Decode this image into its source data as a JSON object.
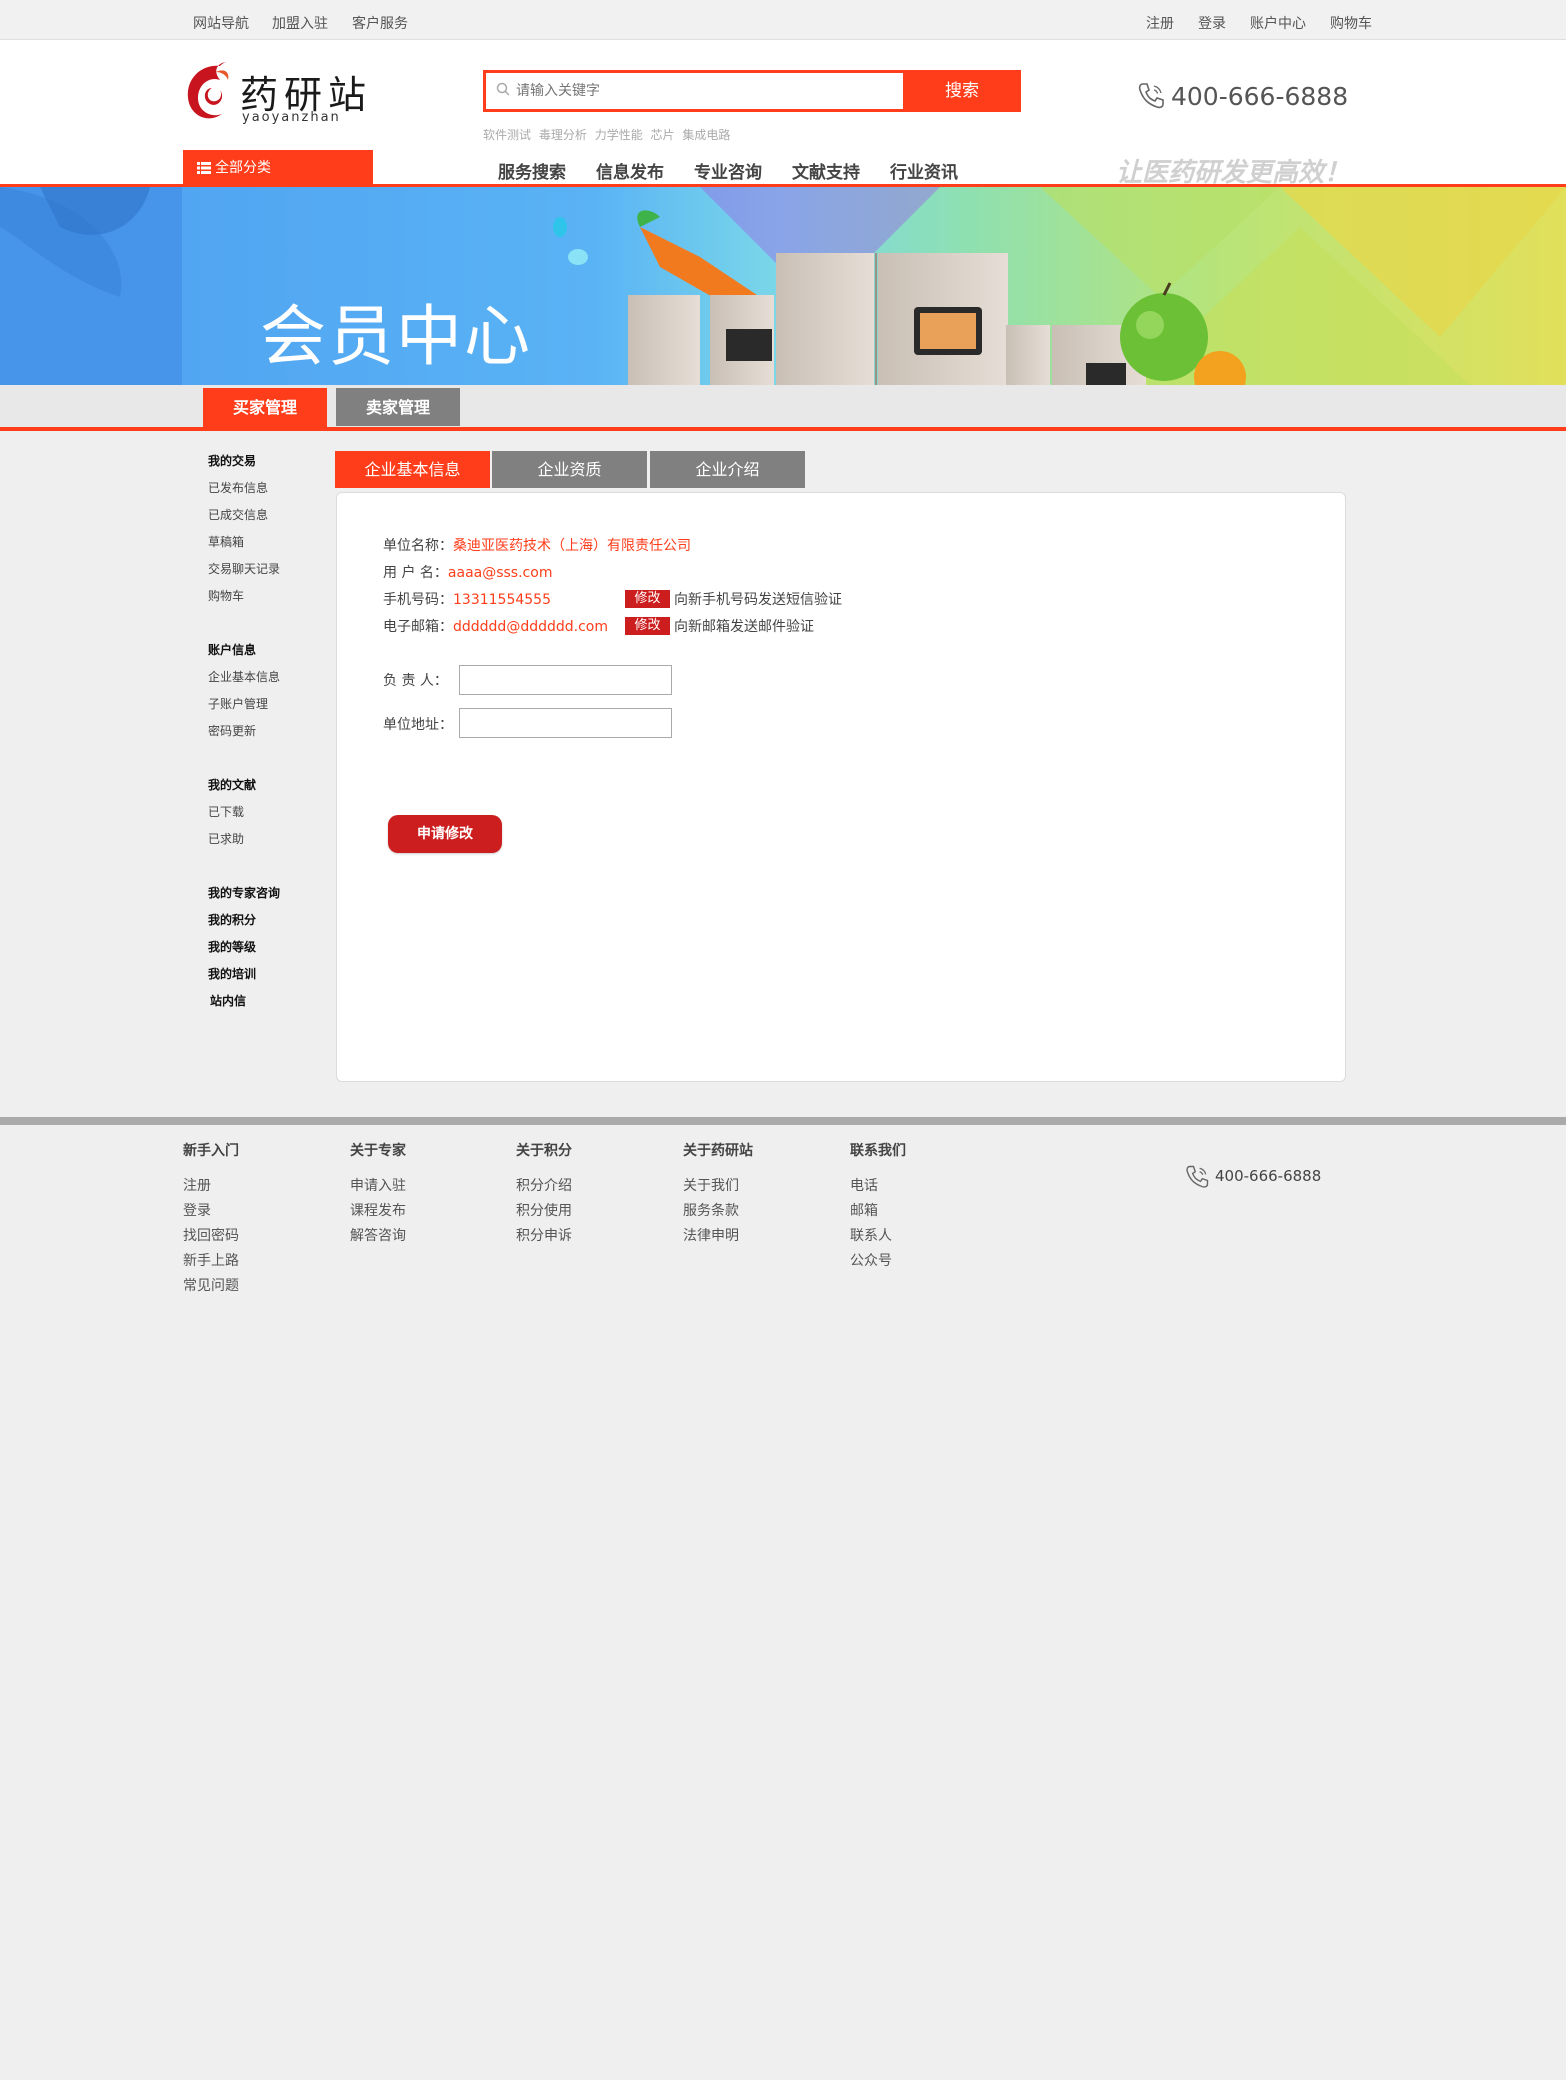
{
  "topbar": {
    "left_links": [
      "网站导航",
      "加盟入驻",
      "客户服务"
    ],
    "right_links": [
      "注册",
      "登录",
      "账户中心",
      "购物车"
    ]
  },
  "logo": {
    "name": "药研站",
    "pinyin": "yaoyanzhan"
  },
  "search": {
    "placeholder": "请输入关键字",
    "button": "搜索"
  },
  "hotwords": [
    "软件测试",
    "毒理分析",
    "力学性能",
    "芯片",
    "集成电路"
  ],
  "phone": "400-666-6888",
  "all_categories": "全部分类",
  "nav": [
    "服务搜索",
    "信息发布",
    "专业咨询",
    "文献支持",
    "行业资讯"
  ],
  "slogan": "让医药研发更高效！",
  "banner": {
    "title": "会员中心"
  },
  "role_tabs": [
    "买家管理",
    "卖家管理"
  ],
  "sidebar": {
    "groups": [
      {
        "title": "我的交易",
        "items": [
          "已发布信息",
          "已成交信息",
          "草稿箱",
          "交易聊天记录",
          "购物车"
        ]
      },
      {
        "title": "账户信息",
        "items": [
          "企业基本信息",
          "子账户管理",
          "密码更新"
        ]
      },
      {
        "title": "我的文献",
        "items": [
          "已下载",
          "已求助"
        ]
      }
    ],
    "extras": [
      "我的专家咨询",
      "我的积分",
      "我的等级",
      "我的培训",
      "站内信"
    ]
  },
  "content_tabs": [
    "企业基本信息",
    "企业资质",
    "企业介绍"
  ],
  "form": {
    "company_label": "单位名称：",
    "company_value": "桑迪亚医药技术（上海）有限责任公司",
    "username_label": "用 户 名：",
    "username_value": "aaaa@sss.com",
    "mobile_label": "手机号码：",
    "mobile_value": "13311554555",
    "email_label": "电子邮箱：",
    "email_value": "dddddd@dddddd.com",
    "edit_label": "修改",
    "mobile_hint": "向新手机号码发送短信验证",
    "email_hint": "向新邮箱发送邮件验证",
    "owner_label": "负 责 人：",
    "address_label": "单位地址：",
    "owner_value": "",
    "address_value": "",
    "submit": "申请修改"
  },
  "footer": {
    "columns": [
      {
        "title": "新手入门",
        "links": [
          "注册",
          "登录",
          "找回密码",
          "新手上路",
          "常见问题"
        ]
      },
      {
        "title": "关于专家",
        "links": [
          "申请入驻",
          "课程发布",
          "解答咨询"
        ]
      },
      {
        "title": "关于积分",
        "links": [
          "积分介绍",
          "积分使用",
          "积分申诉"
        ]
      },
      {
        "title": "关于药研站",
        "links": [
          "关于我们",
          "服务条款",
          "法律申明"
        ]
      },
      {
        "title": "联系我们",
        "links": [
          "电话",
          "邮箱",
          "联系人",
          "公众号"
        ]
      }
    ],
    "phone": "400-666-6888"
  },
  "colors": {
    "accent": "#ff3d1a",
    "edit_red": "#cc1e1e",
    "tab_gray": "#808080"
  }
}
